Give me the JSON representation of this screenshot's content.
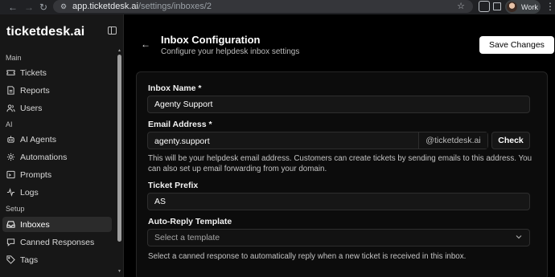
{
  "browser": {
    "url_host": "app.ticketdesk.ai",
    "url_path": "/settings/inboxes/2",
    "profile_label": "Work"
  },
  "sidebar": {
    "brand": "ticketdesk.ai",
    "sections": [
      {
        "label": "Main"
      },
      {
        "label": "AI"
      },
      {
        "label": "Setup"
      }
    ],
    "items": [
      {
        "label": "Tickets",
        "icon": "ticket-icon"
      },
      {
        "label": "Reports",
        "icon": "reports-icon"
      },
      {
        "label": "Users",
        "icon": "users-icon"
      },
      {
        "label": "AI Agents",
        "icon": "bot-icon"
      },
      {
        "label": "Automations",
        "icon": "automation-icon"
      },
      {
        "label": "Prompts",
        "icon": "prompt-icon"
      },
      {
        "label": "Logs",
        "icon": "logs-icon"
      },
      {
        "label": "Inboxes",
        "icon": "inbox-icon",
        "active": true
      },
      {
        "label": "Canned Responses",
        "icon": "message-icon"
      },
      {
        "label": "Tags",
        "icon": "tag-icon"
      }
    ]
  },
  "header": {
    "title": "Inbox Configuration",
    "subtitle": "Configure your helpdesk inbox settings",
    "save_label": "Save Changes"
  },
  "form": {
    "inbox_name": {
      "label": "Inbox Name *",
      "value": "Agenty Support"
    },
    "email": {
      "label": "Email Address *",
      "value": "agenty.support",
      "suffix": "@ticketdesk.ai",
      "check_label": "Check",
      "help": "This will be your helpdesk email address. Customers can create tickets by sending emails to this address. You can also set up email forwarding from your domain."
    },
    "ticket_prefix": {
      "label": "Ticket Prefix",
      "value": "AS"
    },
    "auto_reply": {
      "label": "Auto-Reply Template",
      "placeholder": "Select a template",
      "help": "Select a canned response to automatically reply when a new ticket is received in this inbox."
    }
  },
  "colors": {
    "background": "#000000",
    "sidebar": "#171717",
    "active_item": "#2b2b2b",
    "button_primary": "#ffffff"
  }
}
